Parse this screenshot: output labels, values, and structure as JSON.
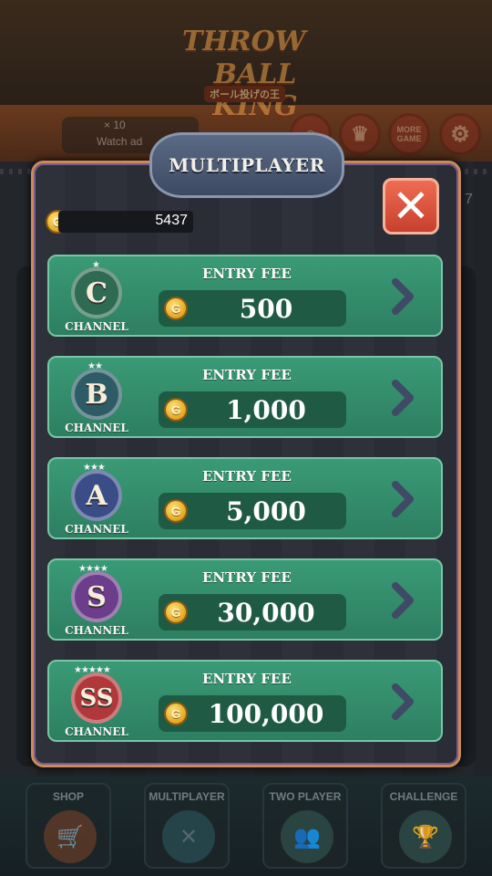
{
  "background": {
    "logo": {
      "line1": "THROW",
      "line2": "BALL KING",
      "subtitle": "ボール投げの王"
    },
    "watch_ad_text": "Watch ad",
    "gem_count": "× 10",
    "more_game_label": "MORE GAME",
    "gem_right_count": "7"
  },
  "modal": {
    "title": "MULTIPLAYER",
    "balance": "5437",
    "coin_glyph": "G",
    "close_glyph": "✕",
    "channels": [
      {
        "grade": "C",
        "stars": "★",
        "channel_label": "CHANNEL",
        "entry_label": "ENTRY FEE",
        "fee": "500",
        "color": "#2f6a53"
      },
      {
        "grade": "B",
        "stars": "★★",
        "channel_label": "CHANNEL",
        "entry_label": "ENTRY FEE",
        "fee": "1,000",
        "color": "#2d5b66"
      },
      {
        "grade": "A",
        "stars": "★★★",
        "channel_label": "CHANNEL",
        "entry_label": "ENTRY FEE",
        "fee": "5,000",
        "color": "#3a4d86"
      },
      {
        "grade": "S",
        "stars": "★★★★",
        "channel_label": "CHANNEL",
        "entry_label": "ENTRY FEE",
        "fee": "30,000",
        "color": "#6b3d8a"
      },
      {
        "grade": "SS",
        "stars": "★★★★★",
        "channel_label": "CHANNEL",
        "entry_label": "ENTRY FEE",
        "fee": "100,000",
        "color": "#b0383a"
      }
    ]
  },
  "bottom_nav": {
    "items": [
      {
        "label": "SHOP",
        "icon": "cart-icon",
        "color": "#5c3a28"
      },
      {
        "label": "MULTIPLAYER",
        "icon": "crossed-icon",
        "color": "#284a50"
      },
      {
        "label": "TWO PLAYER",
        "icon": "players-icon",
        "color": "#2e4a46"
      },
      {
        "label": "CHALLENGE",
        "icon": "trophy-icon",
        "color": "#2e4a46"
      }
    ]
  }
}
